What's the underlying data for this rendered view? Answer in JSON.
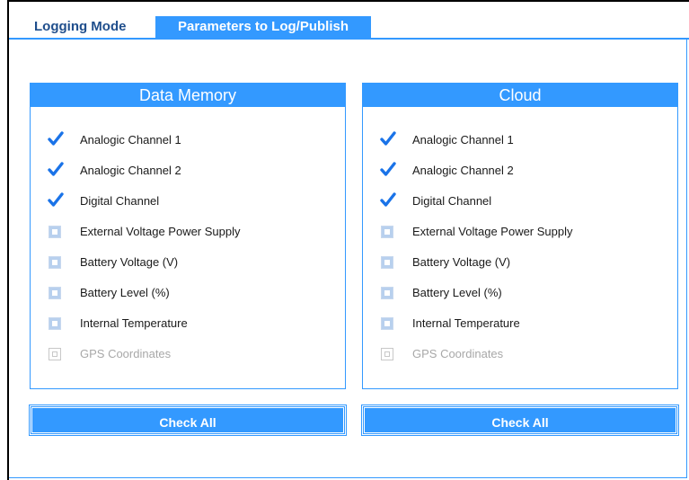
{
  "tabs": {
    "logging_mode": "Logging Mode",
    "parameters": "Parameters to Log/Publish"
  },
  "sections": {
    "data_memory": {
      "title": "Data Memory",
      "button": "Check All",
      "items": [
        {
          "label": "Analogic Channel 1",
          "state": "checked"
        },
        {
          "label": "Analogic Channel 2",
          "state": "checked"
        },
        {
          "label": "Digital Channel",
          "state": "checked"
        },
        {
          "label": "External Voltage Power Supply",
          "state": "unchecked"
        },
        {
          "label": "Battery Voltage (V)",
          "state": "unchecked"
        },
        {
          "label": "Battery Level (%)",
          "state": "unchecked"
        },
        {
          "label": "Internal Temperature",
          "state": "unchecked"
        },
        {
          "label": "GPS Coordinates",
          "state": "disabled"
        }
      ]
    },
    "cloud": {
      "title": "Cloud",
      "button": "Check All",
      "items": [
        {
          "label": "Analogic Channel 1",
          "state": "checked"
        },
        {
          "label": "Analogic Channel 2",
          "state": "checked"
        },
        {
          "label": "Digital Channel",
          "state": "checked"
        },
        {
          "label": "External Voltage Power Supply",
          "state": "unchecked"
        },
        {
          "label": "Battery Voltage (V)",
          "state": "unchecked"
        },
        {
          "label": "Battery Level (%)",
          "state": "unchecked"
        },
        {
          "label": "Internal Temperature",
          "state": "unchecked"
        },
        {
          "label": "GPS Coordinates",
          "state": "disabled"
        }
      ]
    }
  },
  "colors": {
    "accent": "#3399ff",
    "tab_text": "#1f4e8c",
    "check": "#1a73e8",
    "disabled_text": "#a8a8a8"
  }
}
